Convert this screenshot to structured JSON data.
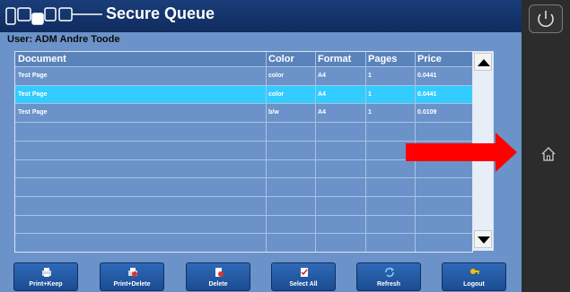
{
  "header": {
    "title": "Secure Queue"
  },
  "user_line": "User: ADM Andre Toode",
  "table": {
    "columns": [
      "Document",
      "Color",
      "Format",
      "Pages",
      "Price"
    ],
    "rows": [
      {
        "document": "Test Page",
        "color": "color",
        "format": "A4",
        "pages": "1",
        "price": "0.0441",
        "selected": false
      },
      {
        "document": "Test Page",
        "color": "color",
        "format": "A4",
        "pages": "1",
        "price": "0.0441",
        "selected": true
      },
      {
        "document": "Test Page",
        "color": "b/w",
        "format": "A4",
        "pages": "1",
        "price": "0.0109",
        "selected": false
      }
    ],
    "empty_rows": 7
  },
  "toolbar": {
    "buttons": [
      {
        "label": "Print+Keep",
        "icon": "printer-icon"
      },
      {
        "label": "Print+Delete",
        "icon": "printer-delete-icon"
      },
      {
        "label": "Delete",
        "icon": "document-delete-icon"
      },
      {
        "label": "Select All",
        "icon": "checklist-icon"
      },
      {
        "label": "Refresh",
        "icon": "refresh-icon"
      },
      {
        "label": "Logout",
        "icon": "key-icon"
      }
    ]
  },
  "side": {
    "power_icon": "power-icon",
    "home_icon": "home-icon"
  },
  "colors": {
    "selected_row": "#33ccff",
    "header_bar": "#1a3d7a",
    "background": "#6b93c9",
    "arrow": "#ff0000"
  }
}
